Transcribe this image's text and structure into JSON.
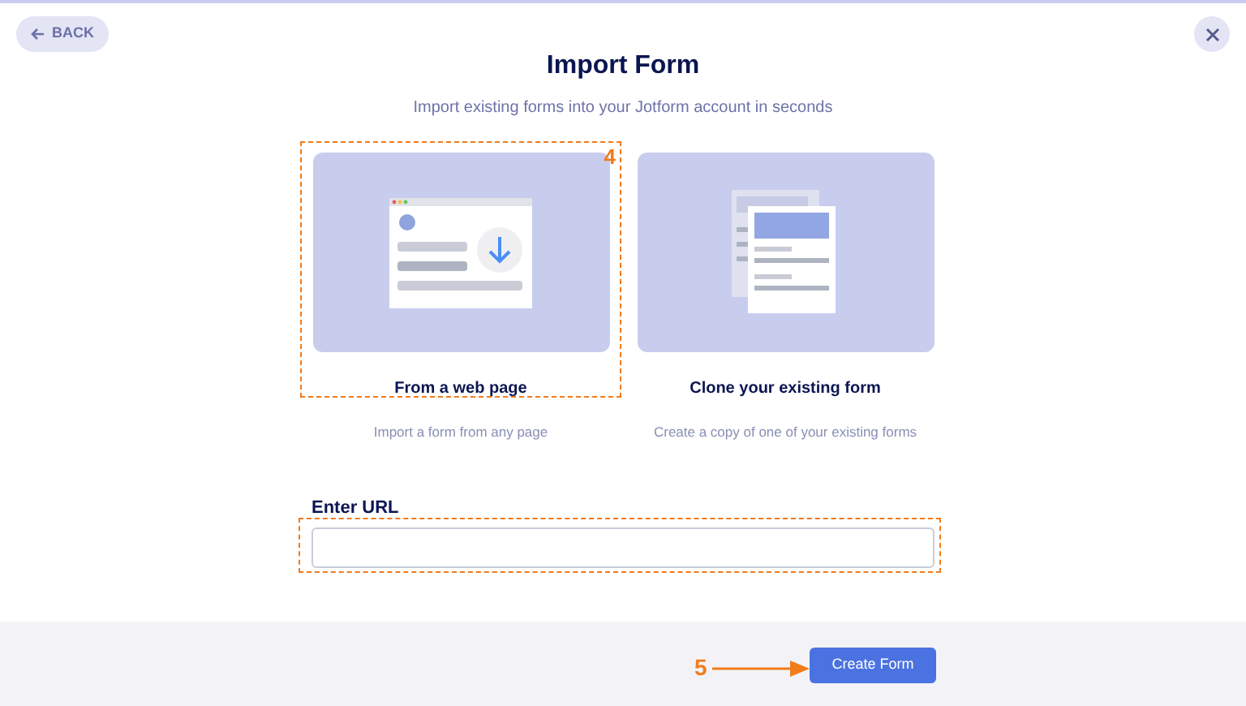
{
  "back_button": {
    "label": "BACK"
  },
  "title": "Import Form",
  "subtitle": "Import existing forms into your Jotform account in seconds",
  "options": [
    {
      "kind": "web",
      "title": "From a web page",
      "description": "Import a form from any page",
      "highlighted": true,
      "callout": "4"
    },
    {
      "kind": "clone",
      "title": "Clone your existing form",
      "description": "Create a copy of one of your existing forms",
      "highlighted": false
    }
  ],
  "url_field": {
    "label": "Enter URL",
    "highlighted": true
  },
  "create_button": {
    "label": "Create Form",
    "callout": "5"
  }
}
